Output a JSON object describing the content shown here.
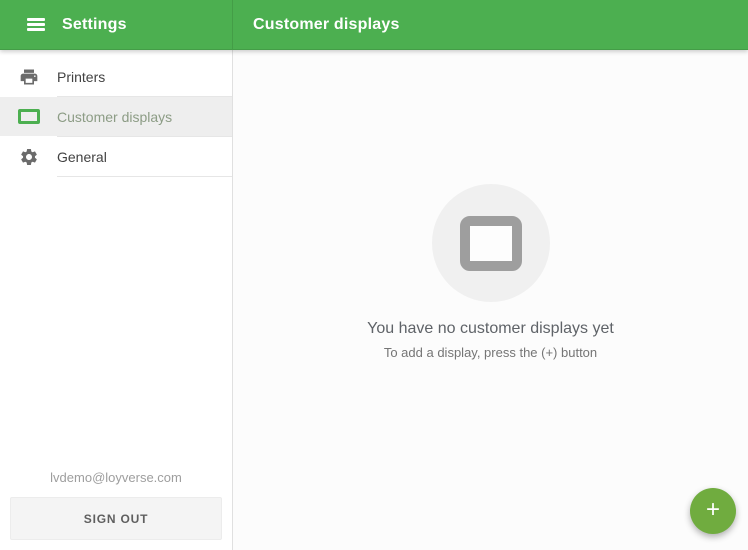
{
  "header": {
    "left_title": "Settings",
    "right_title": "Customer displays"
  },
  "sidebar": {
    "items": [
      {
        "label": "Printers",
        "icon": "printer-icon",
        "active": false
      },
      {
        "label": "Customer displays",
        "icon": "display-icon",
        "active": true
      },
      {
        "label": "General",
        "icon": "gear-icon",
        "active": false
      }
    ],
    "account_email": "lvdemo@loyverse.com",
    "sign_out_label": "SIGN OUT"
  },
  "main": {
    "empty_state": {
      "icon": "display-icon",
      "title": "You have no customer displays yet",
      "subtitle": "To add a display, press the (+) button"
    },
    "fab": {
      "icon": "plus-icon",
      "plus_glyph": "+"
    }
  },
  "colors": {
    "header_green": "#4CAF50",
    "fab_green": "#70AC3F",
    "active_green": "#4CAF50"
  }
}
